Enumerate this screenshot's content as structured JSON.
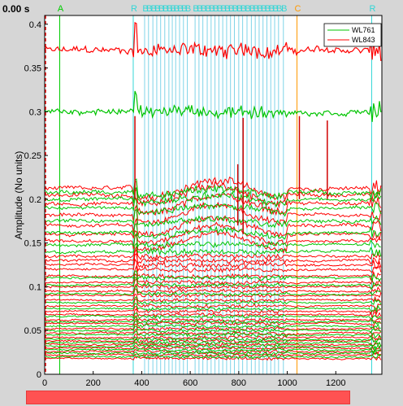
{
  "time_label": "0.00 s",
  "colors": {
    "wl761": "#00c400",
    "wl843": "#ff0000",
    "event_line": "#7fd4e8",
    "marker_A": "#00cc00",
    "marker_R": "#33d6d6",
    "marker_B": "#33d6d6",
    "marker_C": "#ff9900",
    "cursor": "#ff0000",
    "scrollbar": "#ff5252"
  },
  "chart_data": {
    "type": "line",
    "ylabel": "Amplitude (No units)",
    "xlabel": "",
    "xlim": [
      0,
      1390
    ],
    "ylim": [
      0,
      0.41
    ],
    "x_ticks": [
      "0",
      "200",
      "400",
      "600",
      "800",
      "1000",
      "1200"
    ],
    "x_tick_values": [
      0,
      200,
      400,
      600,
      800,
      1000,
      1200
    ],
    "y_ticks": [
      "0",
      "0.05",
      "0.1",
      "0.15",
      "0.2",
      "0.25",
      "0.3",
      "0.35",
      "0.4"
    ],
    "y_tick_values": [
      0,
      0.05,
      0.1,
      0.15,
      0.2,
      0.25,
      0.3,
      0.35,
      0.4
    ],
    "legend": {
      "placement": "top-right",
      "entries": [
        {
          "label": "WL761",
          "color": "#00c400"
        },
        {
          "label": "WL843",
          "color": "#ff0000"
        }
      ]
    },
    "event_markers": [
      {
        "label": "A",
        "x": 62
      },
      {
        "label": "R",
        "x": 365
      },
      {
        "label": "B",
        "x": 412
      },
      {
        "label": "B",
        "x": 428
      },
      {
        "label": "B",
        "x": 446
      },
      {
        "label": "B",
        "x": 462
      },
      {
        "label": "B",
        "x": 478
      },
      {
        "label": "B",
        "x": 495
      },
      {
        "label": "B",
        "x": 512
      },
      {
        "label": "B",
        "x": 526
      },
      {
        "label": "B",
        "x": 540
      },
      {
        "label": "B",
        "x": 556
      },
      {
        "label": "B",
        "x": 572
      },
      {
        "label": "B",
        "x": 588
      },
      {
        "label": "B",
        "x": 620
      },
      {
        "label": "B",
        "x": 636
      },
      {
        "label": "B",
        "x": 652
      },
      {
        "label": "B",
        "x": 670
      },
      {
        "label": "B",
        "x": 686
      },
      {
        "label": "B",
        "x": 702
      },
      {
        "label": "B",
        "x": 718
      },
      {
        "label": "B",
        "x": 734
      },
      {
        "label": "B",
        "x": 750
      },
      {
        "label": "B",
        "x": 766
      },
      {
        "label": "B",
        "x": 782
      },
      {
        "label": "B",
        "x": 800
      },
      {
        "label": "B",
        "x": 816
      },
      {
        "label": "B",
        "x": 834
      },
      {
        "label": "B",
        "x": 852
      },
      {
        "label": "B",
        "x": 868
      },
      {
        "label": "B",
        "x": 884
      },
      {
        "label": "B",
        "x": 900
      },
      {
        "label": "B",
        "x": 916
      },
      {
        "label": "B",
        "x": 932
      },
      {
        "label": "B",
        "x": 948
      },
      {
        "label": "B",
        "x": 964
      },
      {
        "label": "B",
        "x": 984
      },
      {
        "label": "C",
        "x": 1040
      },
      {
        "label": "R",
        "x": 1348
      }
    ],
    "cursor_x": 0,
    "series": [
      {
        "name": "WL843",
        "values_note_free": true,
        "baselines": [
          0.37,
          0.212,
          0.205,
          0.195,
          0.182,
          0.17,
          0.16,
          0.152,
          0.135,
          0.13,
          0.125,
          0.12,
          0.112,
          0.105,
          0.1,
          0.095,
          0.09,
          0.085,
          0.078,
          0.072,
          0.068,
          0.062,
          0.058,
          0.052,
          0.047,
          0.042,
          0.038,
          0.034,
          0.03,
          0.026,
          0.022,
          0.018
        ]
      },
      {
        "name": "WL761",
        "baselines": [
          0.3,
          0.208,
          0.2,
          0.19,
          0.175,
          0.162,
          0.148,
          0.14,
          0.11,
          0.102,
          0.092,
          0.082,
          0.075,
          0.066,
          0.06,
          0.055,
          0.05,
          0.045,
          0.04,
          0.036,
          0.032,
          0.028,
          0.024,
          0.02
        ]
      }
    ]
  }
}
